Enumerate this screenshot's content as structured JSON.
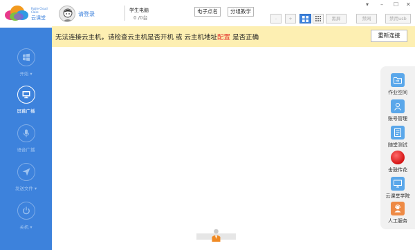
{
  "app": {
    "logo_en": "Ruijie Cloud Class",
    "logo_cn": "云课堂"
  },
  "sidebar": {
    "items": [
      {
        "label": "开始 ▾",
        "icon": "windows-icon"
      },
      {
        "label": "屏幕广播",
        "icon": "monitor-icon"
      },
      {
        "label": "语音广播",
        "icon": "microphone-icon"
      },
      {
        "label": "发送文件 ▾",
        "icon": "send-icon"
      },
      {
        "label": "关机 ▾",
        "icon": "power-icon"
      }
    ]
  },
  "header": {
    "login_label": "请登录",
    "pc_title": "学生电脑",
    "pc_count": "0 /0台",
    "btn_rollcall": "电子点名",
    "btn_group": "分组教学",
    "btn_minus": "-",
    "btn_plus": "+",
    "btn_blackscreen": "黑屏",
    "btn_disable_net": "禁网",
    "btn_disable_usb": "禁用usb"
  },
  "warning": {
    "text_before": "无法连接云主机，请检查云主机是否开机 或 云主机地址",
    "link": "配置",
    "text_after": " 是否正确",
    "button": "重新连接"
  },
  "tools": [
    {
      "label": "作业空间",
      "icon": "folder-icon"
    },
    {
      "label": "账号管理",
      "icon": "user-icon"
    },
    {
      "label": "随堂测试",
      "icon": "document-icon"
    },
    {
      "label": "击鼓传花",
      "icon": "drum-icon"
    },
    {
      "label": "云课堂学院",
      "icon": "screen-icon"
    },
    {
      "label": "人工服务",
      "icon": "service-icon"
    }
  ],
  "colors": {
    "sidebar": "#3d82dc",
    "warning_bg": "#fdefb2",
    "warning_link": "#e4322b",
    "accent": "#3d82dc"
  }
}
